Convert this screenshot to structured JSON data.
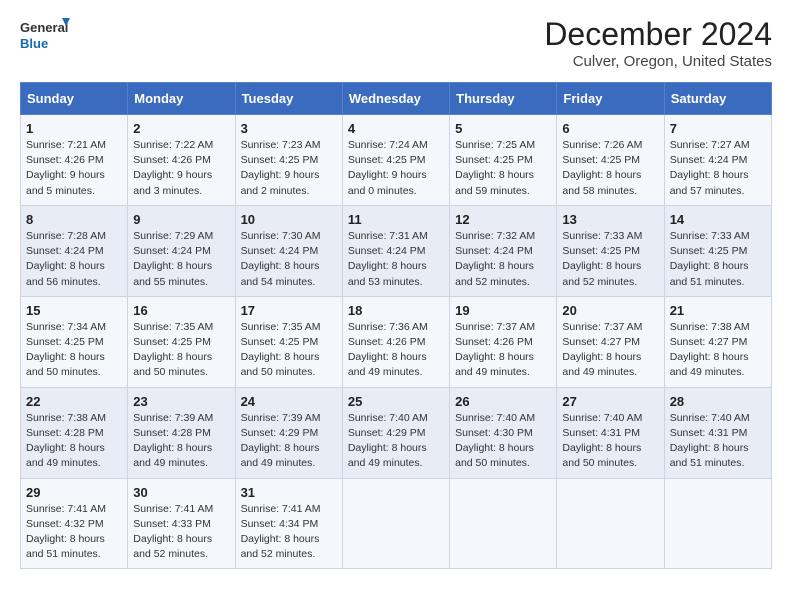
{
  "logo": {
    "general": "General",
    "blue": "Blue"
  },
  "title": "December 2024",
  "subtitle": "Culver, Oregon, United States",
  "days_of_week": [
    "Sunday",
    "Monday",
    "Tuesday",
    "Wednesday",
    "Thursday",
    "Friday",
    "Saturday"
  ],
  "weeks": [
    [
      {
        "day": "1",
        "sunrise": "7:21 AM",
        "sunset": "4:26 PM",
        "daylight": "9 hours and 5 minutes."
      },
      {
        "day": "2",
        "sunrise": "7:22 AM",
        "sunset": "4:26 PM",
        "daylight": "9 hours and 3 minutes."
      },
      {
        "day": "3",
        "sunrise": "7:23 AM",
        "sunset": "4:25 PM",
        "daylight": "9 hours and 2 minutes."
      },
      {
        "day": "4",
        "sunrise": "7:24 AM",
        "sunset": "4:25 PM",
        "daylight": "9 hours and 0 minutes."
      },
      {
        "day": "5",
        "sunrise": "7:25 AM",
        "sunset": "4:25 PM",
        "daylight": "8 hours and 59 minutes."
      },
      {
        "day": "6",
        "sunrise": "7:26 AM",
        "sunset": "4:25 PM",
        "daylight": "8 hours and 58 minutes."
      },
      {
        "day": "7",
        "sunrise": "7:27 AM",
        "sunset": "4:24 PM",
        "daylight": "8 hours and 57 minutes."
      }
    ],
    [
      {
        "day": "8",
        "sunrise": "7:28 AM",
        "sunset": "4:24 PM",
        "daylight": "8 hours and 56 minutes."
      },
      {
        "day": "9",
        "sunrise": "7:29 AM",
        "sunset": "4:24 PM",
        "daylight": "8 hours and 55 minutes."
      },
      {
        "day": "10",
        "sunrise": "7:30 AM",
        "sunset": "4:24 PM",
        "daylight": "8 hours and 54 minutes."
      },
      {
        "day": "11",
        "sunrise": "7:31 AM",
        "sunset": "4:24 PM",
        "daylight": "8 hours and 53 minutes."
      },
      {
        "day": "12",
        "sunrise": "7:32 AM",
        "sunset": "4:24 PM",
        "daylight": "8 hours and 52 minutes."
      },
      {
        "day": "13",
        "sunrise": "7:33 AM",
        "sunset": "4:25 PM",
        "daylight": "8 hours and 52 minutes."
      },
      {
        "day": "14",
        "sunrise": "7:33 AM",
        "sunset": "4:25 PM",
        "daylight": "8 hours and 51 minutes."
      }
    ],
    [
      {
        "day": "15",
        "sunrise": "7:34 AM",
        "sunset": "4:25 PM",
        "daylight": "8 hours and 50 minutes."
      },
      {
        "day": "16",
        "sunrise": "7:35 AM",
        "sunset": "4:25 PM",
        "daylight": "8 hours and 50 minutes."
      },
      {
        "day": "17",
        "sunrise": "7:35 AM",
        "sunset": "4:25 PM",
        "daylight": "8 hours and 50 minutes."
      },
      {
        "day": "18",
        "sunrise": "7:36 AM",
        "sunset": "4:26 PM",
        "daylight": "8 hours and 49 minutes."
      },
      {
        "day": "19",
        "sunrise": "7:37 AM",
        "sunset": "4:26 PM",
        "daylight": "8 hours and 49 minutes."
      },
      {
        "day": "20",
        "sunrise": "7:37 AM",
        "sunset": "4:27 PM",
        "daylight": "8 hours and 49 minutes."
      },
      {
        "day": "21",
        "sunrise": "7:38 AM",
        "sunset": "4:27 PM",
        "daylight": "8 hours and 49 minutes."
      }
    ],
    [
      {
        "day": "22",
        "sunrise": "7:38 AM",
        "sunset": "4:28 PM",
        "daylight": "8 hours and 49 minutes."
      },
      {
        "day": "23",
        "sunrise": "7:39 AM",
        "sunset": "4:28 PM",
        "daylight": "8 hours and 49 minutes."
      },
      {
        "day": "24",
        "sunrise": "7:39 AM",
        "sunset": "4:29 PM",
        "daylight": "8 hours and 49 minutes."
      },
      {
        "day": "25",
        "sunrise": "7:40 AM",
        "sunset": "4:29 PM",
        "daylight": "8 hours and 49 minutes."
      },
      {
        "day": "26",
        "sunrise": "7:40 AM",
        "sunset": "4:30 PM",
        "daylight": "8 hours and 50 minutes."
      },
      {
        "day": "27",
        "sunrise": "7:40 AM",
        "sunset": "4:31 PM",
        "daylight": "8 hours and 50 minutes."
      },
      {
        "day": "28",
        "sunrise": "7:40 AM",
        "sunset": "4:31 PM",
        "daylight": "8 hours and 51 minutes."
      }
    ],
    [
      {
        "day": "29",
        "sunrise": "7:41 AM",
        "sunset": "4:32 PM",
        "daylight": "8 hours and 51 minutes."
      },
      {
        "day": "30",
        "sunrise": "7:41 AM",
        "sunset": "4:33 PM",
        "daylight": "8 hours and 52 minutes."
      },
      {
        "day": "31",
        "sunrise": "7:41 AM",
        "sunset": "4:34 PM",
        "daylight": "8 hours and 52 minutes."
      },
      null,
      null,
      null,
      null
    ]
  ],
  "labels": {
    "sunrise": "Sunrise:",
    "sunset": "Sunset:",
    "daylight": "Daylight:"
  }
}
